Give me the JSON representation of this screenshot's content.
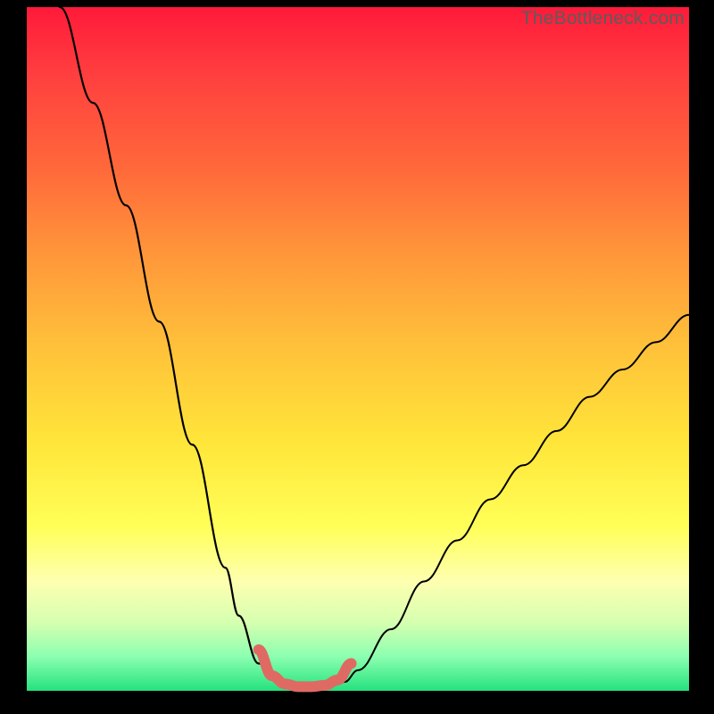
{
  "watermark": "TheBottleneck.com",
  "colors": {
    "page_bg": "#000000",
    "gradient_top": "#ff1a3a",
    "gradient_bottom": "#24e27e",
    "curve_stroke": "#000000",
    "highlight_stroke": "#df6a63"
  },
  "chart_data": {
    "type": "line",
    "title": "",
    "xlabel": "",
    "ylabel": "",
    "xlim": [
      0,
      100
    ],
    "ylim": [
      0,
      100
    ],
    "series": [
      {
        "name": "left-curve",
        "x": [
          5,
          10,
          15,
          20,
          25,
          30,
          32,
          35,
          38,
          40,
          42
        ],
        "values": [
          100,
          86,
          71,
          54,
          36,
          18,
          11,
          4,
          1.3,
          0.7,
          0.6
        ]
      },
      {
        "name": "right-curve",
        "x": [
          44,
          46,
          48,
          50,
          55,
          60,
          65,
          70,
          75,
          80,
          85,
          90,
          95,
          100
        ],
        "values": [
          0.6,
          0.7,
          1.3,
          3,
          9,
          16,
          22,
          28,
          33,
          38,
          43,
          47,
          51,
          55
        ]
      },
      {
        "name": "highlight-valley",
        "x": [
          35,
          37,
          39,
          41,
          43,
          45,
          47,
          49
        ],
        "values": [
          6,
          2.2,
          1.0,
          0.6,
          0.6,
          0.8,
          1.6,
          4
        ]
      }
    ],
    "annotations": []
  }
}
